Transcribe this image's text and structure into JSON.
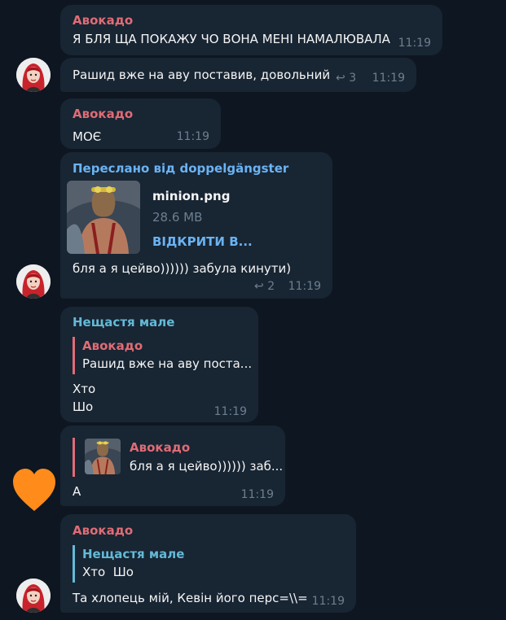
{
  "messages": [
    {
      "sender": "Авокадо",
      "text": "Я БЛЯ ЩА ПОКАЖУ ЧО ВОНА МЕНІ НАМАЛЮВАЛА",
      "time": "11:19"
    },
    {
      "text": "Рашид вже на аву поставив, довольний",
      "replies": "3",
      "time": "11:19"
    },
    {
      "sender": "Авокадо",
      "text": "МОЄ",
      "time": "11:19"
    },
    {
      "forwarded": "Переслано від doppelgängster",
      "file_name": "minion.png",
      "file_size": "28.6 MB",
      "file_action": "ВІДКРИТИ В...",
      "text": "бля а я цейво)))))) забула кинути)",
      "replies": "2",
      "time": "11:19"
    },
    {
      "sender": "Нещастя мале",
      "quote_sender": "Авокадо",
      "quote_text": "Рашид вже на аву поста...",
      "line1": "Хто",
      "line2": "Шо",
      "time": "11:19"
    },
    {
      "quote_sender": "Авокадо",
      "quote_text": "бля а я цейво)))))) заб...",
      "text": "А",
      "time": "11:19"
    },
    {
      "sender": "Авокадо",
      "quote_sender": "Нещастя мале",
      "quote_text": "Хто  Шо",
      "text": "Та хлопець мій, Кевін його перс=\\\\=",
      "time": "11:19"
    }
  ],
  "icons": {
    "reply": "reply-arrow-icon",
    "avatar": "user-avatar",
    "heart": "orange-heart-icon"
  },
  "colors": {
    "background": "#0e1621",
    "bubble": "#182533",
    "sender_red": "#e06c75",
    "sender_teal": "#64b9d6",
    "link": "#6ab3f3",
    "heart": "#ff8b1a"
  }
}
